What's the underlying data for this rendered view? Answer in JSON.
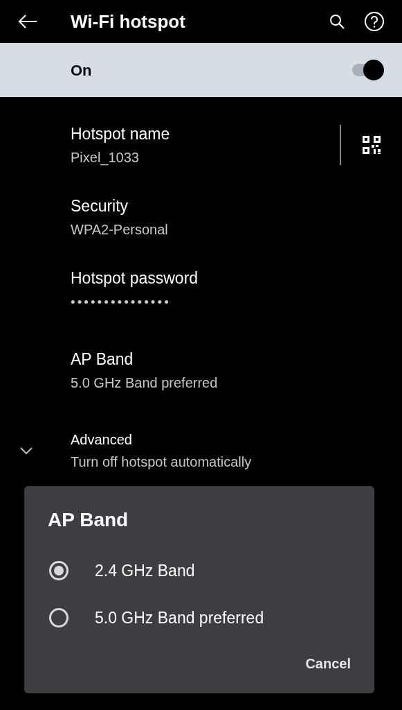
{
  "app_bar": {
    "title": "Wi-Fi hotspot"
  },
  "main_switch": {
    "label": "On",
    "on": true
  },
  "settings": [
    {
      "kind": "qr",
      "title": "Hotspot name",
      "summary": "Pixel_1033"
    },
    {
      "kind": "plain",
      "title": "Security",
      "summary": "WPA2-Personal"
    },
    {
      "kind": "password",
      "title": "Hotspot password",
      "summary": "•••••••••••••••"
    },
    {
      "kind": "plain",
      "title": "AP Band",
      "summary": "5.0 GHz Band preferred"
    },
    {
      "kind": "expand",
      "title": "Advanced",
      "summary": "Turn off hotspot automatically"
    }
  ],
  "dialog": {
    "title": "AP Band",
    "options": [
      {
        "label": "2.4 GHz Band",
        "selected": true
      },
      {
        "label": "5.0 GHz Band preferred",
        "selected": false
      }
    ],
    "buttons": [
      "Cancel"
    ]
  }
}
